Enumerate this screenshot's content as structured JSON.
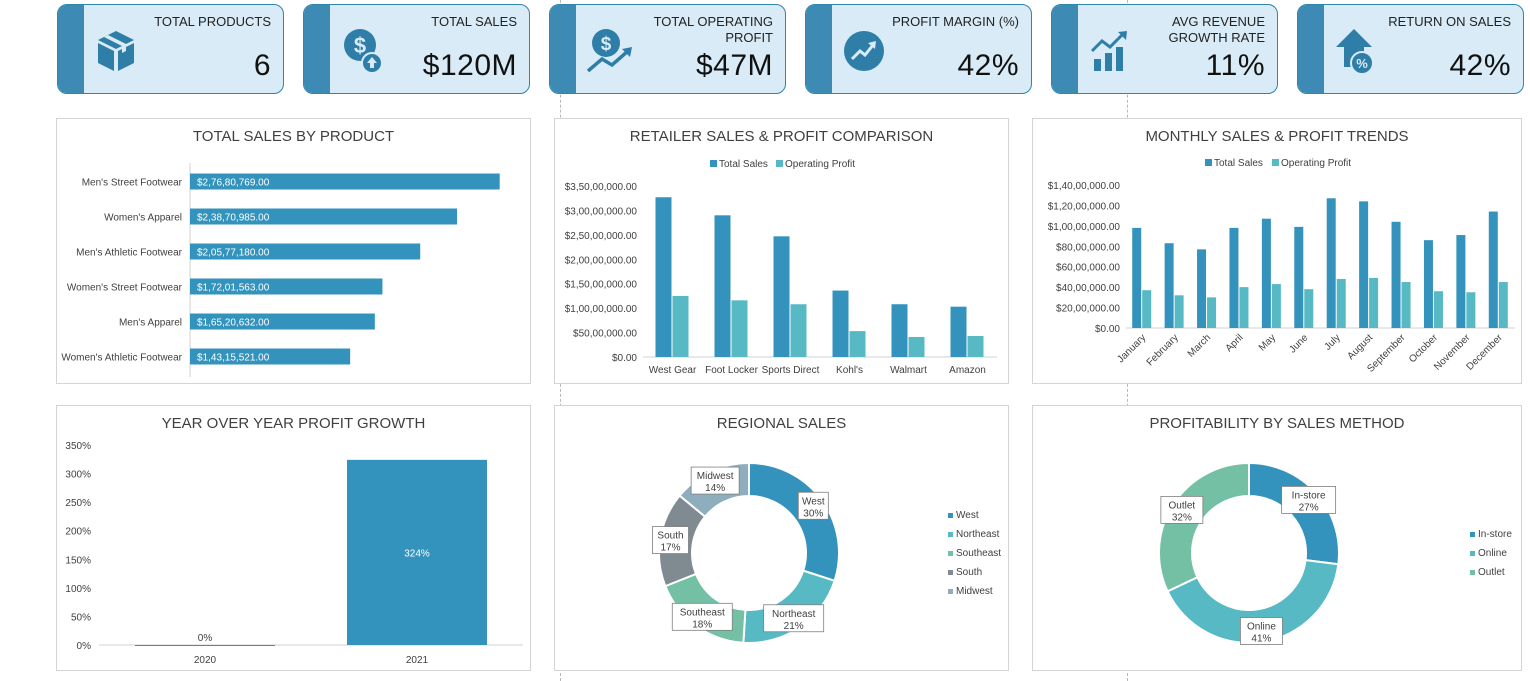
{
  "colors": {
    "primary": "#3393bc",
    "secondary": "#56b9c3",
    "kpi_bg": "#d9ebf6",
    "kpi_strip": "#3d8ab5",
    "icon": "#2f7ea8"
  },
  "kpis": [
    {
      "title": "TOTAL PRODUCTS",
      "value": "6",
      "icon": "box-icon"
    },
    {
      "title": "TOTAL SALES",
      "value": "$120M",
      "icon": "dollar-upload-icon"
    },
    {
      "title": "TOTAL OPERATING\nPROFIT",
      "value": "$47M",
      "icon": "dollar-trend-icon"
    },
    {
      "title": "PROFIT MARGIN (%)",
      "value": "42%",
      "icon": "trend-circle-icon"
    },
    {
      "title": "AVG REVENUE\nGROWTH RATE",
      "value": "11%",
      "icon": "growth-bars-icon"
    },
    {
      "title": "RETURN ON SALES",
      "value": "42%",
      "icon": "house-percent-icon"
    }
  ],
  "panels": {
    "product": {
      "title": "TOTAL SALES BY PRODUCT"
    },
    "retailer": {
      "title": "RETAILER SALES & PROFIT COMPARISON"
    },
    "monthly": {
      "title": "MONTHLY SALES & PROFIT TRENDS"
    },
    "yoy": {
      "title": "YEAR OVER YEAR PROFIT GROWTH"
    },
    "regional": {
      "title": "REGIONAL SALES"
    },
    "method": {
      "title": "PROFITABILITY BY SALES METHOD"
    }
  },
  "chart_data": [
    {
      "id": "product",
      "type": "bar",
      "orientation": "horizontal",
      "categories": [
        "Men's Street Footwear",
        "Women's Apparel",
        "Men's Athletic Footwear",
        "Women's Street Footwear",
        "Men's Apparel",
        "Women's Athletic Footwear"
      ],
      "values": [
        27680769,
        23870985,
        20577180,
        17201563,
        16520632,
        14315521
      ],
      "labels": [
        "$2,76,80,769.00",
        "$2,38,70,985.00",
        "$2,05,77,180.00",
        "$1,72,01,563.00",
        "$1,65,20,632.00",
        "$1,43,15,521.00"
      ],
      "xlim": [
        0,
        32000000
      ]
    },
    {
      "id": "retailer",
      "type": "bar",
      "categories": [
        "West Gear",
        "Foot Locker",
        "Sports Direct",
        "Kohl's",
        "Walmart",
        "Amazon"
      ],
      "series": [
        {
          "name": "Total Sales",
          "values": [
            32700000,
            29000000,
            24700000,
            13600000,
            10800000,
            10300000
          ]
        },
        {
          "name": "Operating Profit",
          "values": [
            12500000,
            11600000,
            10800000,
            5300000,
            4100000,
            4300000
          ]
        }
      ],
      "ylim": [
        0,
        35000000
      ],
      "yticks": [
        0,
        5000000,
        10000000,
        15000000,
        20000000,
        25000000,
        30000000,
        35000000
      ],
      "ytick_labels": [
        "$0.00",
        "$50,00,000.00",
        "$1,00,00,000.00",
        "$1,50,00,000.00",
        "$2,00,00,000.00",
        "$2,50,00,000.00",
        "$3,00,00,000.00",
        "$3,50,00,000.00"
      ],
      "legend": "top"
    },
    {
      "id": "monthly",
      "type": "bar",
      "categories": [
        "January",
        "February",
        "March",
        "April",
        "May",
        "June",
        "July",
        "August",
        "September",
        "October",
        "November",
        "December"
      ],
      "series": [
        {
          "name": "Total Sales",
          "values": [
            9800000,
            8300000,
            7700000,
            9800000,
            10700000,
            9900000,
            12700000,
            12400000,
            10400000,
            8600000,
            9100000,
            11400000
          ]
        },
        {
          "name": "Operating Profit",
          "values": [
            3700000,
            3200000,
            3000000,
            4000000,
            4300000,
            3800000,
            4800000,
            4900000,
            4500000,
            3600000,
            3500000,
            4500000
          ]
        }
      ],
      "ylim": [
        0,
        14000000
      ],
      "yticks": [
        0,
        2000000,
        4000000,
        6000000,
        8000000,
        10000000,
        12000000,
        14000000
      ],
      "ytick_labels": [
        "$0.00",
        "$20,00,000.00",
        "$40,00,000.00",
        "$60,00,000.00",
        "$80,00,000.00",
        "$1,00,00,000.00",
        "$1,20,00,000.00",
        "$1,40,00,000.00"
      ],
      "legend": "top"
    },
    {
      "id": "yoy",
      "type": "bar",
      "categories": [
        "2020",
        "2021"
      ],
      "values": [
        0,
        3.24
      ],
      "labels": [
        "0%",
        "324%"
      ],
      "ylim": [
        0,
        3.5
      ],
      "yticks": [
        0,
        0.5,
        1,
        1.5,
        2,
        2.5,
        3,
        3.5
      ],
      "ytick_labels": [
        "0%",
        "50%",
        "100%",
        "150%",
        "200%",
        "250%",
        "300%",
        "350%"
      ]
    },
    {
      "id": "regional",
      "type": "pie",
      "donut": true,
      "categories": [
        "West",
        "Northeast",
        "Southeast",
        "South",
        "Midwest"
      ],
      "values": [
        30,
        21,
        18,
        17,
        14
      ],
      "labels": [
        "30%",
        "21%",
        "18%",
        "17%",
        "14%"
      ],
      "colors": [
        "#3393bc",
        "#56b9c3",
        "#74c0a5",
        "#7f8a91",
        "#8eaebd"
      ],
      "legend": "right"
    },
    {
      "id": "method",
      "type": "pie",
      "donut": true,
      "categories": [
        "In-store",
        "Online",
        "Outlet"
      ],
      "values": [
        27,
        41,
        32
      ],
      "labels": [
        "27%",
        "41%",
        "32%"
      ],
      "colors": [
        "#3393bc",
        "#56b9c3",
        "#74c0a5"
      ],
      "legend": "right"
    }
  ]
}
